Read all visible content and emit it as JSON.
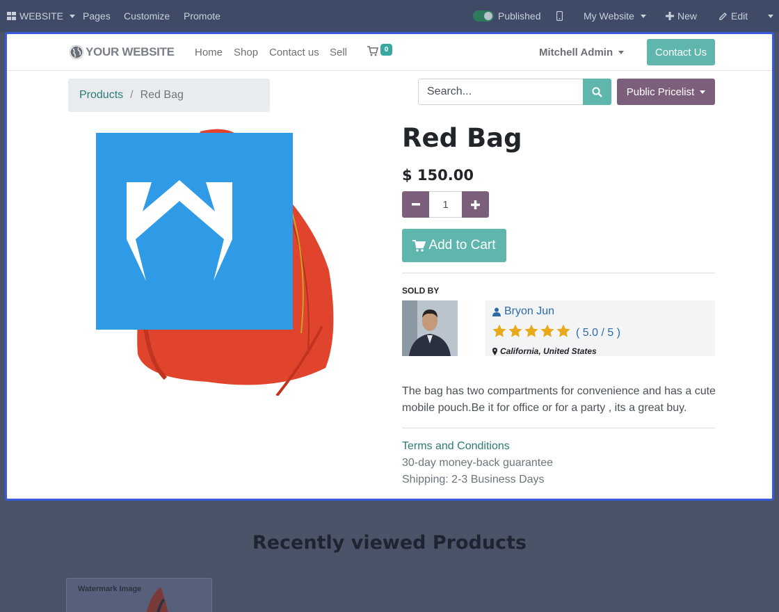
{
  "admin_bar": {
    "app_menu_label": "WEBSITE",
    "pages_label": "Pages",
    "customize_label": "Customize",
    "promote_label": "Promote",
    "published_label": "Published",
    "site_selector_label": "My Website",
    "new_label": "New",
    "edit_label": "Edit"
  },
  "site_nav": {
    "logo_text": "YOUR WEBSITE",
    "links": [
      "Home",
      "Shop",
      "Contact us",
      "Sell"
    ],
    "cart_count": "0",
    "account_label": "Mitchell Admin",
    "contact_button_label": "Contact Us"
  },
  "breadcrumb": {
    "parent": "Products",
    "separator": "/",
    "current": "Red Bag"
  },
  "search": {
    "placeholder": "Search..."
  },
  "pricelist_label": "Public Pricelist",
  "product": {
    "name": "Red Bag",
    "price": "$ 150.00",
    "quantity": "1",
    "add_to_cart_label": "Add to Cart",
    "description": "The bag has two compartments for convenience and has a cute mobile pouch.Be it for office or for a party , its a great buy.",
    "terms_label": "Terms and Conditions",
    "guarantee": "30-day money-back guarantee",
    "shipping": "Shipping: 2-3 Business Days"
  },
  "seller": {
    "sold_by_label": "SOLD BY",
    "name": "Bryon Jun",
    "rating_text": "( 5.0 / 5 )",
    "rating_value": 5.0,
    "rating_max": 5,
    "location": "California, United States"
  },
  "recently_viewed": {
    "title": "Recently viewed Products",
    "card_watermark": "Watermark Image"
  },
  "colors": {
    "accent_teal": "#5fb6ad",
    "accent_purple": "#7c5f7a",
    "admin_bar": "#3f4a67",
    "edit_frame": "#3a5bd9",
    "logo_blue": "#2f9be6",
    "star_gold": "#e8a91a"
  },
  "icons": {
    "app_menu": "grid-icon",
    "mobile_preview": "mobile-icon",
    "new": "plus-icon",
    "edit": "pencil-icon",
    "cart": "shopping-cart-icon",
    "search": "search-icon",
    "seller": "user-icon",
    "location": "map-marker-icon"
  }
}
